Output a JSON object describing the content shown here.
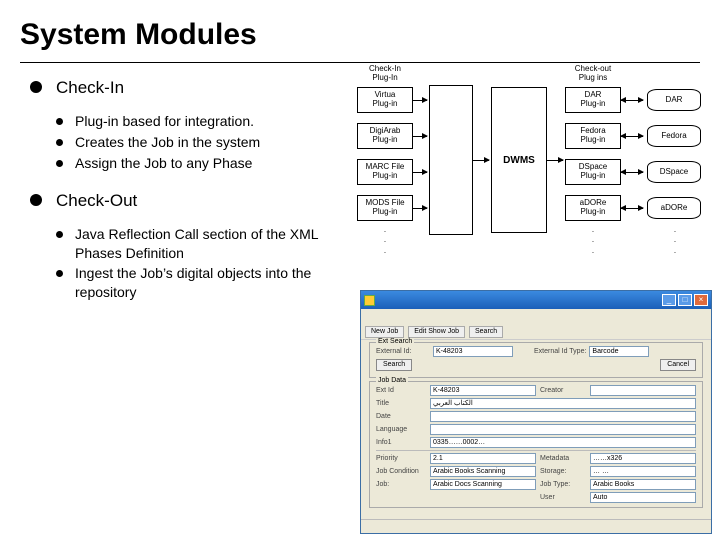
{
  "title": "System Modules",
  "bullets": {
    "checkin": {
      "label": "Check-In",
      "items": [
        "Plug-in based for integration.",
        "Creates the Job in the system",
        "Assign the Job to any Phase"
      ]
    },
    "checkout": {
      "label": "Check-Out",
      "items": [
        "Java Reflection Call section of the XML Phases Definition",
        "Ingest the Job’s digital objects into the repository"
      ]
    }
  },
  "diagram": {
    "col_left_label": "Check-In\nPlug-In",
    "col_right_label": "Check-out\nPlug ins",
    "center": "DWMS",
    "left_plugins": [
      "Virtua\nPlug-in",
      "DigiArab\nPlug-in",
      "MARC File\nPlug-in",
      "MODS File\nPlug-in"
    ],
    "right_plugins": [
      "DAR\nPlug-in",
      "Fedora\nPlug-in",
      "DSpace\nPlug-in",
      "aDORe\nPlug-in"
    ],
    "repos": [
      "DAR",
      "Fedora",
      "DSpace",
      "aDORe"
    ]
  },
  "app": {
    "title": "",
    "menu": [
      "",
      "",
      ""
    ],
    "toolbar": [
      "New Job",
      "Edit Show Job",
      "Search"
    ],
    "fs1": {
      "legend": "Ext Search",
      "ext_id_label": "External Id:",
      "ext_id_value": "K-48203",
      "ext_id_type_label": "External Id Type:",
      "ext_id_type_value": "Barcode",
      "btn1": "Search",
      "btn2": "Cancel"
    },
    "fs2": {
      "legend": "Job Data",
      "fields": {
        "ext_id": {
          "label": "Ext Id",
          "value": "K-48203"
        },
        "creator": {
          "label": "Creator",
          "value": ""
        },
        "title": {
          "label": "Title",
          "value": "الكتاب العربي"
        },
        "date": {
          "label": "Date",
          "value": ""
        },
        "lang": {
          "label": "Language",
          "value": ""
        },
        "info1": {
          "label": "Info1",
          "value": "0335……0002…"
        },
        "priority": {
          "label": "Priority",
          "value": "2.1"
        },
        "metadata": {
          "label": "Metadata",
          "value": "……x326"
        },
        "job_cond": {
          "label": "Job Condition",
          "value": "Arabic Books Scanning"
        },
        "job_status": {
          "label": "Job:",
          "value": "Arabic Docs Scanning"
        },
        "storage": {
          "label": "Storage:",
          "value": "… …"
        },
        "job_type": {
          "label": "Job Type:",
          "value": "Arabic Books"
        },
        "user": {
          "label": "User",
          "value": "Auto"
        }
      }
    }
  }
}
